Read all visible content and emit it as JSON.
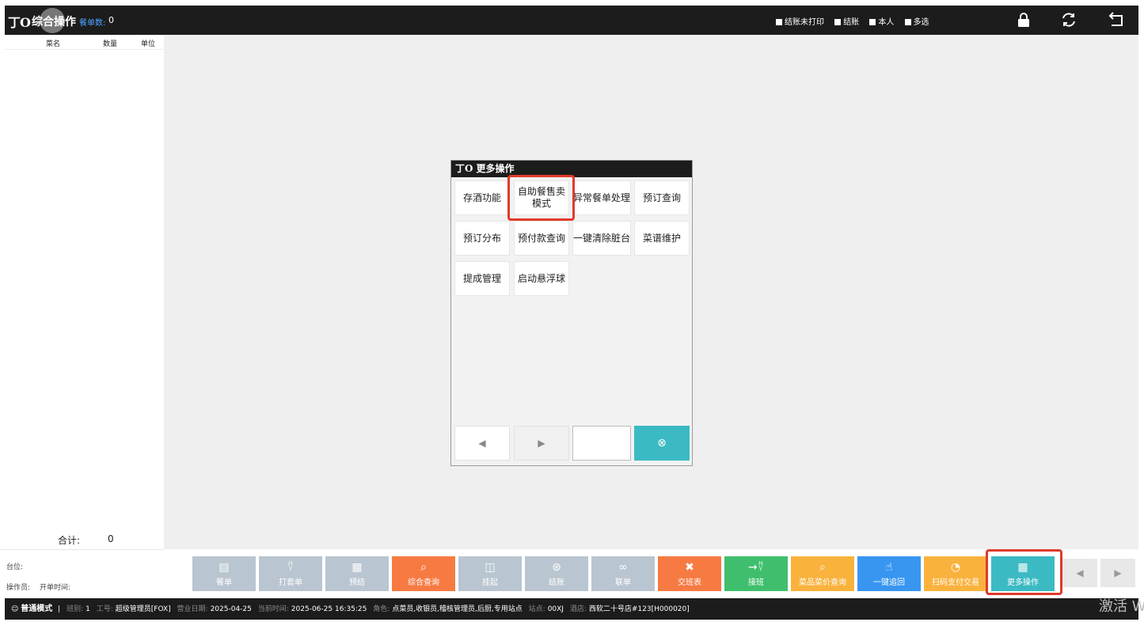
{
  "header": {
    "logo_text": "丁O",
    "title": "综合操作",
    "order_count_label": "餐单数:",
    "order_count_value": "0",
    "filters": [
      "结账未打印",
      "结账",
      "本人",
      "多选"
    ],
    "icons": [
      "lock-icon",
      "refresh-icon",
      "back-icon"
    ]
  },
  "left_panel": {
    "columns": [
      "菜名",
      "数量",
      "单位"
    ],
    "total_label": "合计:",
    "total_value": "0",
    "table_label": "台位:",
    "operator_label": "操作员:",
    "open_time_label": "开单时间:"
  },
  "dialog": {
    "title": "更多操作",
    "options": [
      "存酒功能",
      "自助餐售卖模式",
      "异常餐单处理",
      "预订查询",
      "预订分布",
      "预付款查询",
      "一键清除脏台",
      "菜谱维护",
      "提成管理",
      "启动悬浮球"
    ],
    "prev_icon": "◀",
    "next_icon": "▶",
    "page_input_value": "",
    "close_icon": "⊗"
  },
  "toolbar": {
    "buttons": [
      {
        "label": "餐单",
        "icon": "menu-icon",
        "color": "#b9c5d0"
      },
      {
        "label": "打套单",
        "icon": "user-search-icon",
        "color": "#b9c5d0"
      },
      {
        "label": "预结",
        "icon": "pre-settle-icon",
        "color": "#b9c5d0"
      },
      {
        "label": "综合查询",
        "icon": "search-icon",
        "color": "#f77a43"
      },
      {
        "label": "挂起",
        "icon": "hold-icon",
        "color": "#b9c5d0"
      },
      {
        "label": "结账",
        "icon": "checkout-icon",
        "color": "#b9c5d0"
      },
      {
        "label": "联单",
        "icon": "link-icon",
        "color": "#b9c5d0"
      },
      {
        "label": "交班表",
        "icon": "shift-report-icon",
        "color": "#f77a43"
      },
      {
        "label": "接班",
        "icon": "take-shift-icon",
        "color": "#3fbf6d"
      },
      {
        "label": "菜品菜价查询",
        "icon": "dish-price-search-icon",
        "color": "#f9b23c"
      },
      {
        "label": "一键追回",
        "icon": "recall-icon",
        "color": "#3896f0"
      },
      {
        "label": "扫码支付交易",
        "icon": "scan-pay-icon",
        "color": "#f9b23c"
      },
      {
        "label": "更多操作",
        "icon": "grid-icon",
        "color": "#3cbac3"
      }
    ],
    "prev_icon": "◀",
    "next_icon": "▶"
  },
  "statusbar": {
    "mode": "普通模式",
    "shift_label": "班别:",
    "shift_value": "1",
    "id_label": "工号:",
    "id_value": "超级管理员[FOX]",
    "bizdate_label": "营业日期:",
    "bizdate_value": "2025-04-25",
    "curtime_label": "当前时间:",
    "curtime_value": "2025-06-25 16:35:25",
    "role_label": "角色:",
    "role_value": "点菜员,收银员,稽核管理员,后厨,专用站点",
    "station_label": "站点:",
    "station_value": "00XJ",
    "store_label": "酒店:",
    "store_value": "西软二十号店#123[H000020]"
  },
  "watermark": "激活 W"
}
